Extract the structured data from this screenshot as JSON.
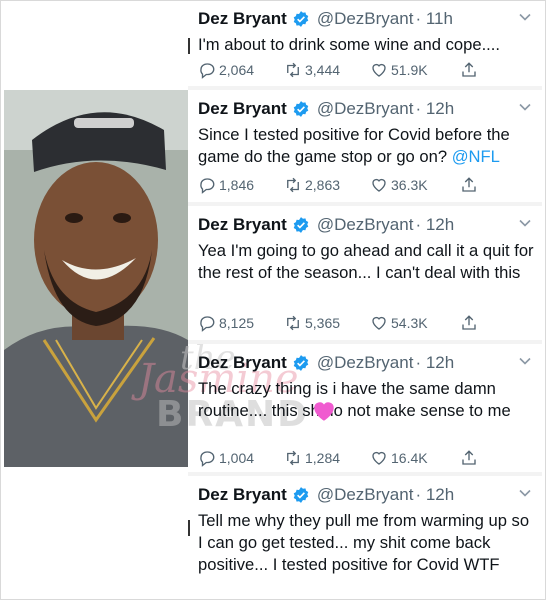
{
  "author": {
    "name": "Dez Bryant",
    "handle": "@DezBryant"
  },
  "colors": {
    "link": "#1d9bf0",
    "verified": "#1d9bf0",
    "muted": "#536471"
  },
  "watermark": {
    "line1": "the",
    "line2": "Jasmine",
    "line3": "BRAND"
  },
  "tweets": [
    {
      "time": "· 11h",
      "text": "I'm about to drink some wine and cope....",
      "replies": "2,064",
      "retweets": "3,444",
      "likes": "51.9K"
    },
    {
      "time": "· 12h",
      "text": "Since I tested positive for Covid before the game do the game stop or go on? ",
      "mention": "@NFL",
      "replies": "1,846",
      "retweets": "2,863",
      "likes": "36.3K"
    },
    {
      "time": "· 12h",
      "text": "Yea I'm going to go ahead and call it a quit for the rest of the season... I can't deal with this",
      "replies": "8,125",
      "retweets": "5,365",
      "likes": "54.3K"
    },
    {
      "time": "· 12h",
      "text": "The crazy thing is i have the same damn routine.... this sh  do not make sense to me",
      "replies": "1,004",
      "retweets": "1,284",
      "likes": "16.4K"
    },
    {
      "time": "· 12h",
      "text": "Tell me why they pull me from warming up so I can go get tested... my shit come back positive... I tested positive for Covid WTF"
    }
  ]
}
